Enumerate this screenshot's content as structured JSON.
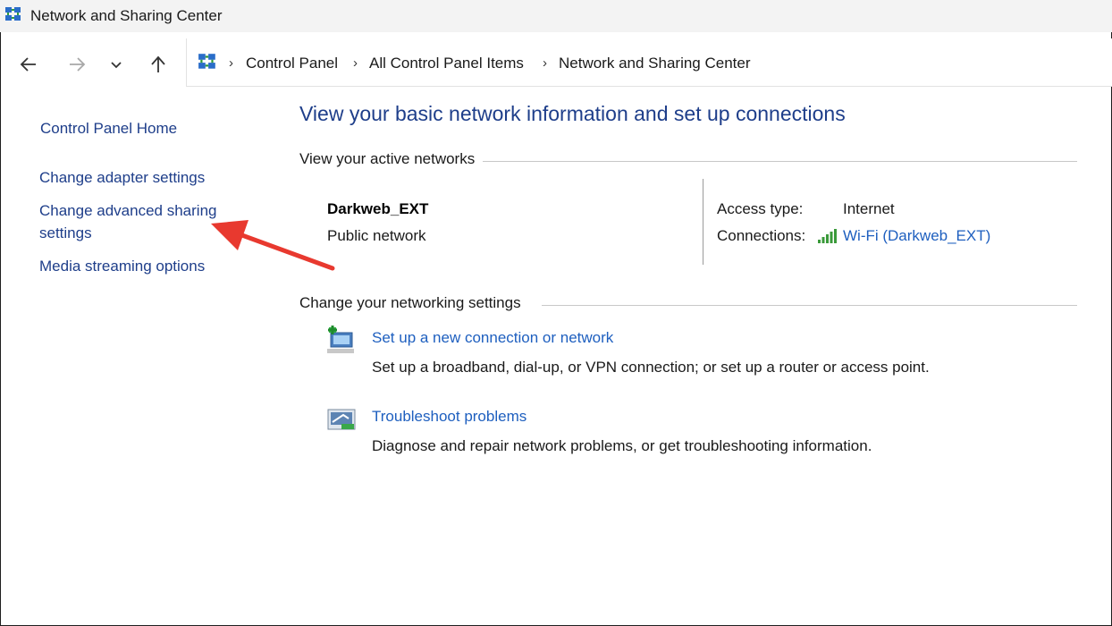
{
  "window": {
    "title": "Network and Sharing Center"
  },
  "nav": {
    "back": "back-arrow-icon",
    "forward": "forward-arrow-icon",
    "recent": "chevron-down-icon",
    "up": "up-arrow-icon"
  },
  "breadcrumb": [
    "Control Panel",
    "All Control Panel Items",
    "Network and Sharing Center"
  ],
  "sidebar": {
    "items": [
      {
        "label": "Control Panel Home"
      },
      {
        "label": "Change adapter settings"
      },
      {
        "label": "Change advanced sharing settings"
      },
      {
        "label": "Media streaming options"
      }
    ]
  },
  "main": {
    "heading": "View your basic network information and set up connections",
    "active_networks": {
      "label": "View your active networks",
      "network_name": "Darkweb_EXT",
      "network_type": "Public network",
      "access_type_label": "Access type:",
      "access_type_value": "Internet",
      "connections_label": "Connections:",
      "connections_value": "Wi-Fi (Darkweb_EXT)"
    },
    "settings": {
      "label": "Change your networking settings",
      "tasks": [
        {
          "icon": "new-connection-icon",
          "link": "Set up a new connection or network",
          "desc": "Set up a broadband, dial-up, or VPN connection; or set up a router or access point."
        },
        {
          "icon": "troubleshoot-icon",
          "link": "Troubleshoot problems",
          "desc": "Diagnose and repair network problems, or get troubleshooting information."
        }
      ]
    }
  },
  "colors": {
    "link": "#1e5fbf",
    "heading": "#1e3e8a",
    "annotation_arrow": "#e8392f"
  }
}
